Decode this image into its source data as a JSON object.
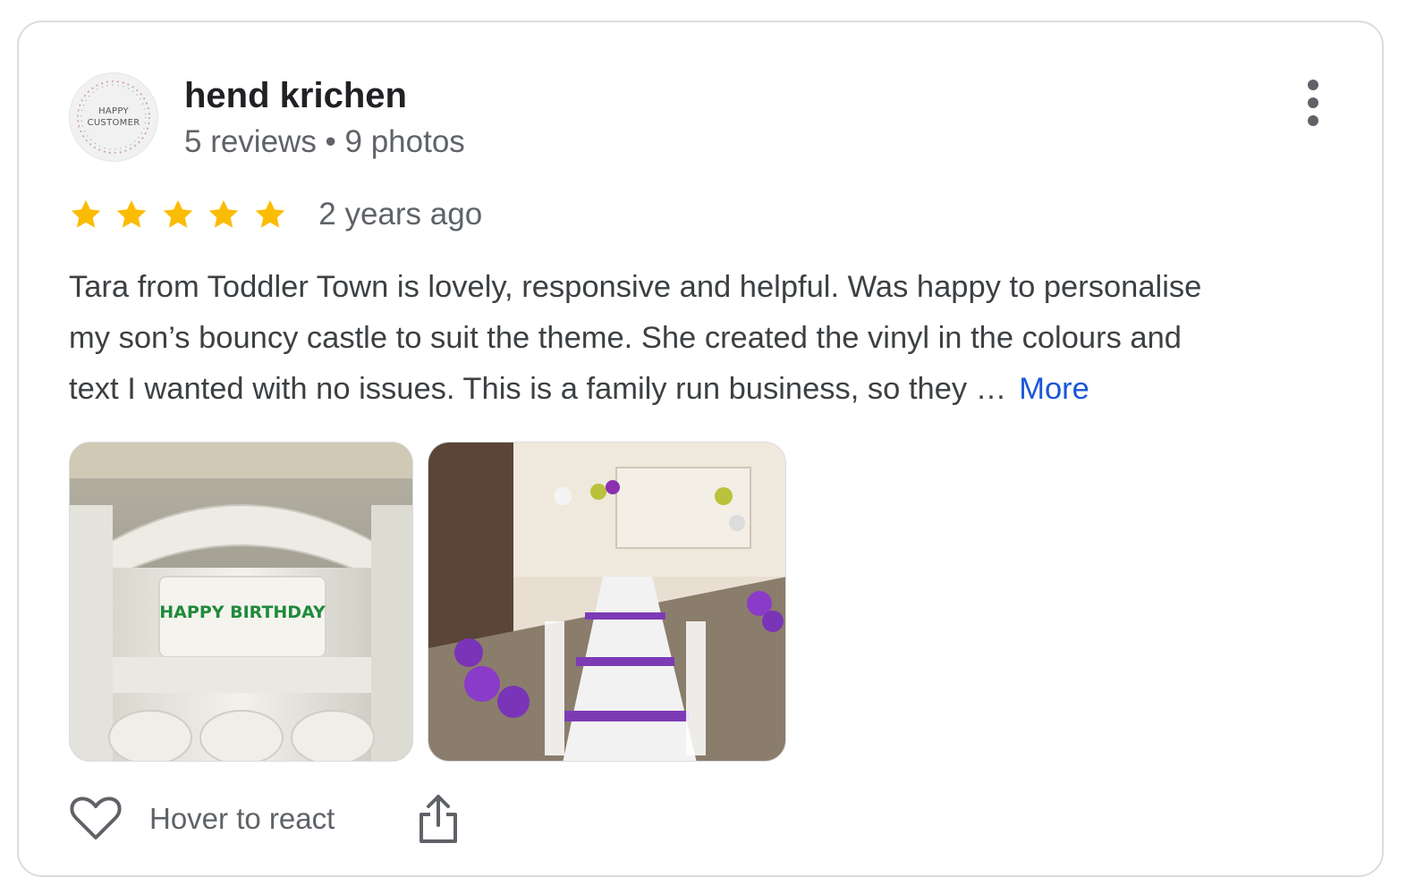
{
  "review": {
    "author": {
      "name": "hend krichen",
      "meta": "5 reviews • 9 photos",
      "avatar_text_line1": "HAPPY",
      "avatar_text_line2": "CUSTOMER"
    },
    "rating": 5,
    "rating_max": 5,
    "time": "2 years ago",
    "text_lines": [
      "Tara from Toddler Town is lovely, responsive and helpful. Was happy to personalise",
      "my son’s bouncy castle to suit the theme. She created the vinyl in the colours and",
      "text I wanted with no issues. This is a family run business, so they …"
    ],
    "more_label": "More",
    "photos": [
      {
        "banner_text": "HAPPY BIRTHDAY"
      },
      {
        "banner_text": ""
      }
    ],
    "actions": {
      "react_label": "Hover to react"
    }
  },
  "colors": {
    "star": "#fbbc04",
    "link": "#1a57d8",
    "secondary_text": "#5f6368",
    "primary_text": "#202124",
    "border": "#dadce0"
  },
  "icons": {
    "menu": "more-vertical-icon",
    "react": "heart-outline-icon",
    "share": "share-icon",
    "star": "star-icon"
  }
}
